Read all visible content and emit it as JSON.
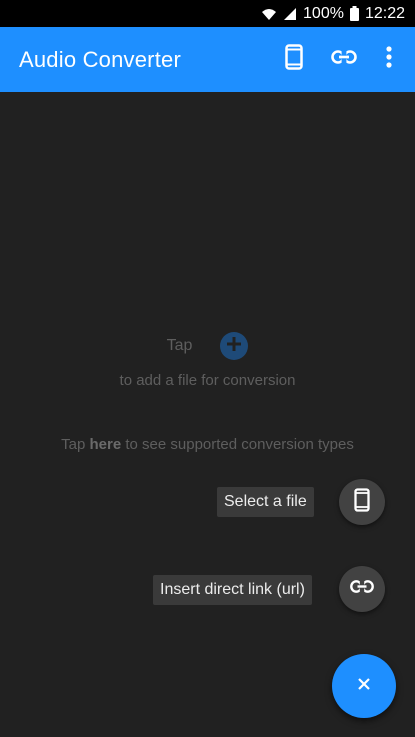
{
  "status_bar": {
    "battery": "100%",
    "time": "12:22"
  },
  "app_bar": {
    "title": "Audio Converter"
  },
  "empty_state": {
    "tap_label": "Tap",
    "subtitle": "to add a file for conversion",
    "supported_prefix": "Tap ",
    "supported_link": "here",
    "supported_suffix": " to see supported conversion types"
  },
  "fab_menu": {
    "select_file_label": "Select a file",
    "direct_link_label": "Insert direct link (url)"
  },
  "icons": {
    "wifi": "wifi-icon",
    "signal": "signal-icon",
    "battery": "battery-icon",
    "device": "phone-icon",
    "link": "link-icon",
    "more": "more-vert-icon",
    "add": "add-icon",
    "close": "close-icon"
  },
  "colors": {
    "accent": "#1e8fff",
    "background": "#212121"
  }
}
